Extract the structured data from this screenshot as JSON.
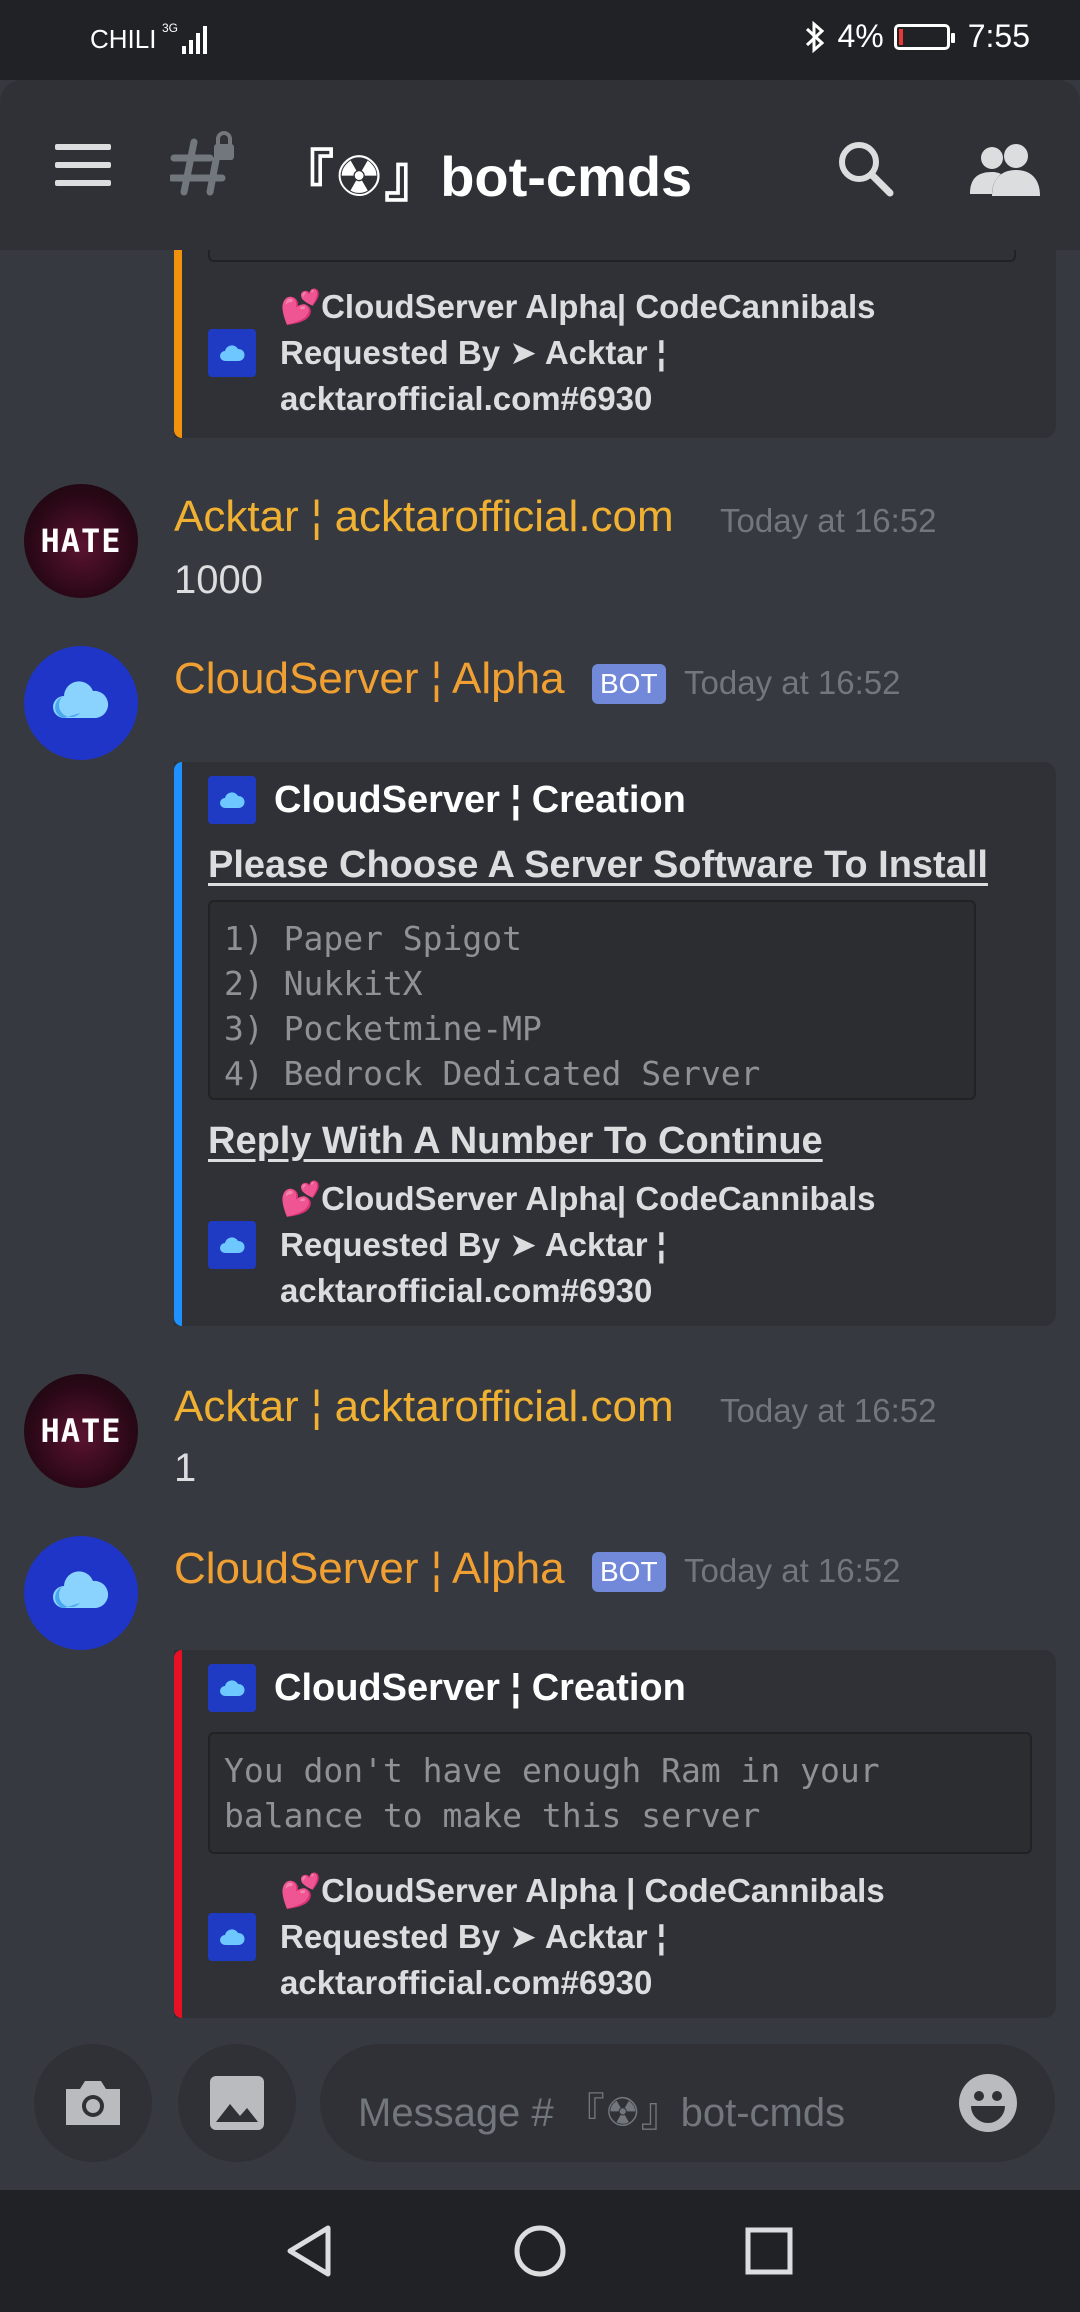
{
  "status": {
    "carrier": "CHILI",
    "network": "3G",
    "battery": "4%",
    "time": "7:55"
  },
  "header": {
    "channel_title": "『☢』bot-cmds"
  },
  "messages": {
    "top_embed_footer": {
      "line1": "💕CloudServer Alpha| CodeCannibals",
      "line2": "Requested By ➤ Acktar ¦",
      "line3": "acktarofficial.com#6930"
    },
    "m1": {
      "author": "Acktar ¦ acktarofficial.com",
      "time": "Today at 16:52",
      "text": "1000"
    },
    "m2": {
      "author": "CloudServer ¦ Alpha",
      "badge": "BOT",
      "time": "Today at 16:52",
      "embed_author": "CloudServer ¦ Creation",
      "field1": "Please Choose A Server Software To Install",
      "code": "1) Paper Spigot\n2) NukkitX\n3) Pocketmine-MP\n4) Bedrock Dedicated Server",
      "field2": "Reply With A Number To Continue",
      "footer1": "💕CloudServer Alpha| CodeCannibals",
      "footer2": "Requested By ➤ Acktar ¦",
      "footer3": "acktarofficial.com#6930"
    },
    "m3": {
      "author": "Acktar ¦ acktarofficial.com",
      "time": "Today at 16:52",
      "text": "1",
      "avatar_text": "HATE"
    },
    "m4": {
      "author": "CloudServer ¦ Alpha",
      "badge": "BOT",
      "time": "Today at 16:52",
      "embed_author": "CloudServer ¦ Creation",
      "code": "You don't have enough Ram in your\nbalance to make this server",
      "footer1": "💕CloudServer Alpha | CodeCannibals",
      "footer2": "Requested By ➤ Acktar ¦",
      "footer3": "acktarofficial.com#6930"
    },
    "avatar_hate_text": "HATE"
  },
  "composer": {
    "placeholder": "Message # 『☢』bot-cmds"
  },
  "colors": {
    "accent_orange": "#f0b132",
    "embed_orange": "#f0920b",
    "embed_blue": "#1e90ff",
    "embed_red": "#e81123",
    "bot_badge": "#7289da"
  }
}
